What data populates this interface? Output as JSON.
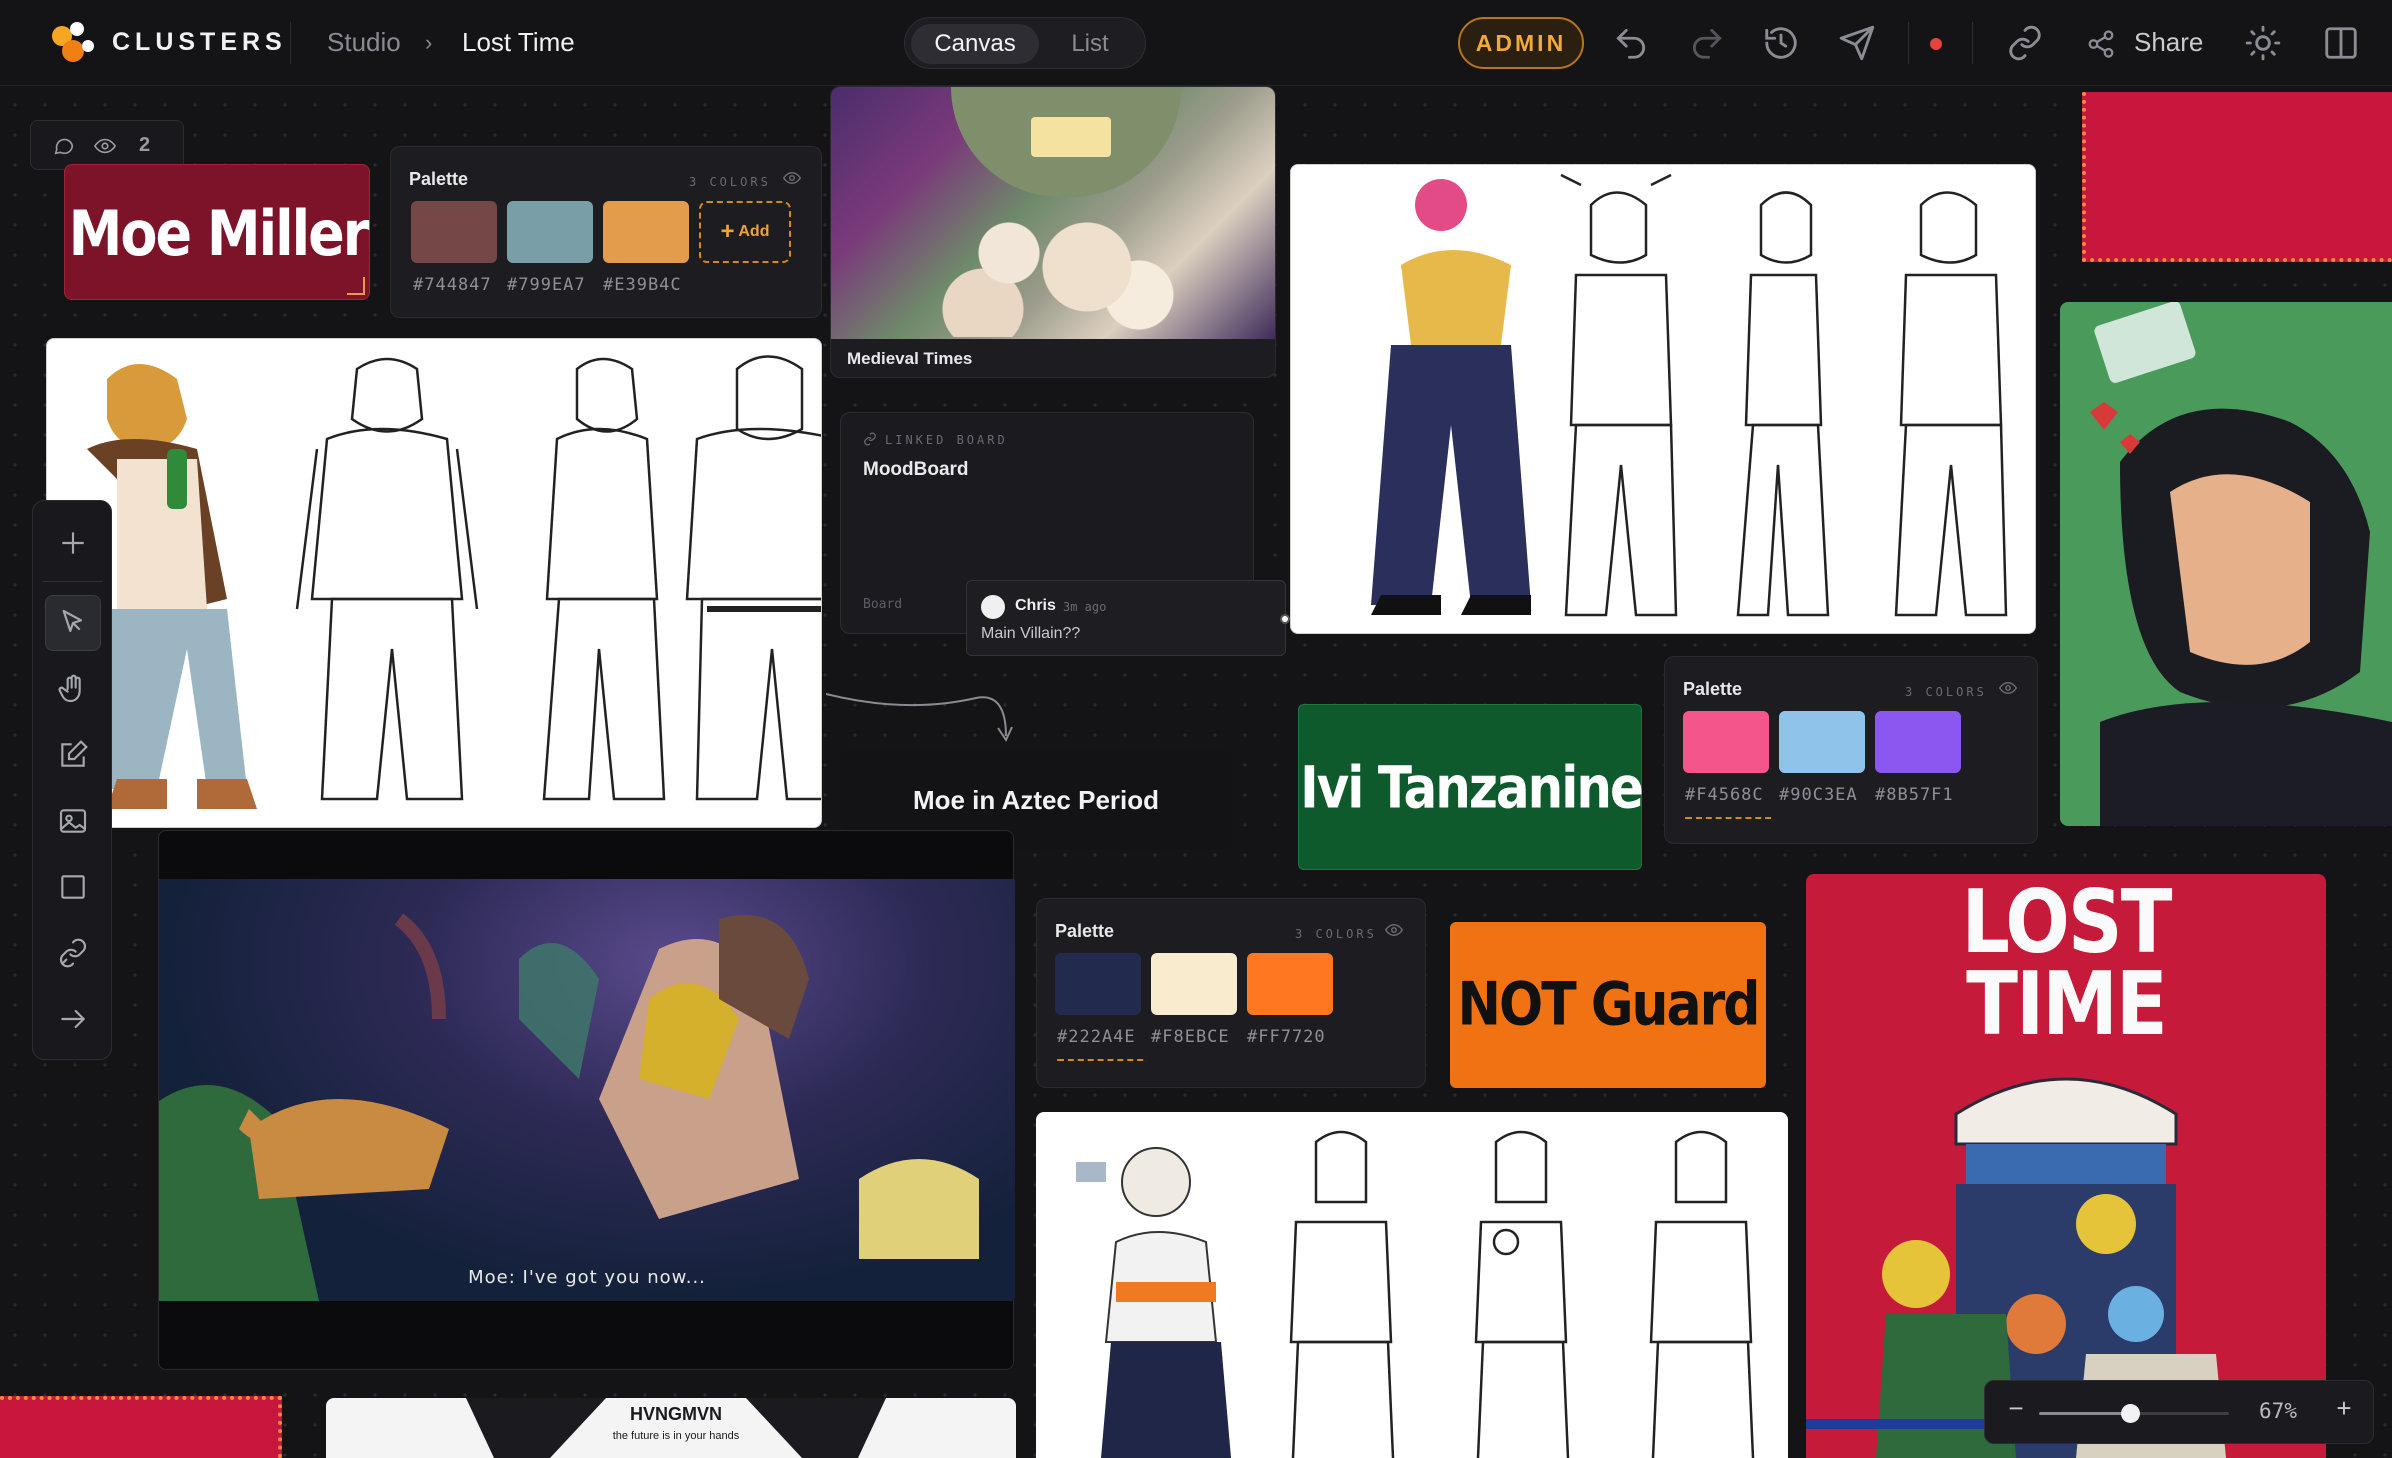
{
  "app": {
    "brand": "CLUSTERS"
  },
  "breadcrumb": {
    "studio": "Studio",
    "separator": "›",
    "board": "Lost Time"
  },
  "view_toggle": {
    "canvas": "Canvas",
    "list": "List"
  },
  "header": {
    "admin": "ADMIN",
    "share": "Share"
  },
  "presence": {
    "viewers": "2"
  },
  "colors": {
    "accent": "#F2A93B",
    "background": "#141417",
    "record": "#E5443C"
  },
  "cards": {
    "moe_name": "Moe Miller",
    "ivi_name": "Ivi Tanzanine",
    "not_name": "NOT Guard",
    "medieval_caption": "Medieval Times",
    "aztec_label": "Moe in Aztec Period",
    "scene_subtitle": "Moe: I've got you now...",
    "poster_title_1": "LOST",
    "poster_title_2": "TIME",
    "strip_title": "HVNGMVN",
    "strip_tagline": "the future is in your hands"
  },
  "linked_board": {
    "tag": "LINKED BOARD",
    "title": "MoodBoard",
    "kind": "Board"
  },
  "comment": {
    "author": "Chris",
    "time": "3m ago",
    "text": "Main Villain??"
  },
  "palettes": [
    {
      "title": "Palette",
      "count": "3 COLORS",
      "colors": [
        "#744847",
        "#799EA7",
        "#E39B4C"
      ],
      "labels": [
        "#744847",
        "#799EA7",
        "#E39B4C"
      ],
      "add": "Add"
    },
    {
      "title": "Palette",
      "count": "3 COLORS",
      "colors": [
        "#F4568C",
        "#90C3EA",
        "#8B57F1"
      ],
      "labels": [
        "#F4568C",
        "#90C3EA",
        "#8B57F1"
      ]
    },
    {
      "title": "Palette",
      "count": "3 COLORS",
      "colors": [
        "#222A4E",
        "#F8EBCE",
        "#FF7720"
      ],
      "labels": [
        "#222A4E",
        "#F8EBCE",
        "#FF7720"
      ]
    }
  ],
  "toolbar": {
    "tools": [
      "plus-icon",
      "select-pointer-icon",
      "hand-icon",
      "edit-note-icon",
      "image-icon",
      "rectangle-icon",
      "link-icon",
      "arrow-right-icon"
    ],
    "active_tool": "select-pointer-icon"
  },
  "zoom": {
    "minus": "−",
    "plus": "+",
    "value": "67%",
    "level": 0.48
  }
}
